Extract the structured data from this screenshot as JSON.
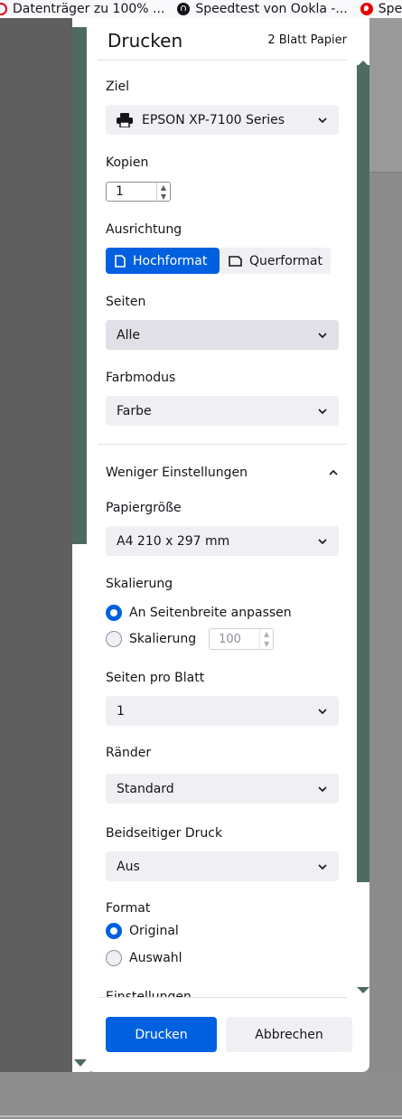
{
  "bookmarks": [
    {
      "label": "Datenträger zu 100% ...",
      "icon": "opera-red-icon"
    },
    {
      "label": "Speedtest von Ookla -...",
      "icon": "ookla-icon"
    },
    {
      "label": "Speed",
      "icon": "vodafone-icon"
    }
  ],
  "dialog": {
    "title": "Drucken",
    "sheet_count": "2 Blatt Papier",
    "destination": {
      "label": "Ziel",
      "value": "EPSON XP-7100 Series"
    },
    "copies": {
      "label": "Kopien",
      "value": "1"
    },
    "orientation": {
      "label": "Ausrichtung",
      "portrait": "Hochformat",
      "landscape": "Querformat",
      "selected": "Hochformat"
    },
    "pages": {
      "label": "Seiten",
      "value": "Alle"
    },
    "color_mode": {
      "label": "Farbmodus",
      "value": "Farbe"
    },
    "fewer_settings": "Weniger Einstellungen",
    "paper_size": {
      "label": "Papiergröße",
      "value": "A4 210 x 297 mm"
    },
    "scaling": {
      "label": "Skalierung",
      "fit_option": "An Seitenbreite anpassen",
      "scale_option": "Skalierung",
      "scale_value": "100",
      "selected": "An Seitenbreite anpassen"
    },
    "pages_per_sheet": {
      "label": "Seiten pro Blatt",
      "value": "1"
    },
    "margins": {
      "label": "Ränder",
      "value": "Standard"
    },
    "duplex": {
      "label": "Beidseitiger Druck",
      "value": "Aus"
    },
    "format": {
      "label": "Format",
      "original": "Original",
      "selection": "Auswahl",
      "selected": "Original"
    },
    "settings_label": "Einstellungen",
    "print_button": "Drucken",
    "cancel_button": "Abbrechen"
  },
  "colors": {
    "accent": "#0060df",
    "preview_green": "#4e6b62"
  }
}
